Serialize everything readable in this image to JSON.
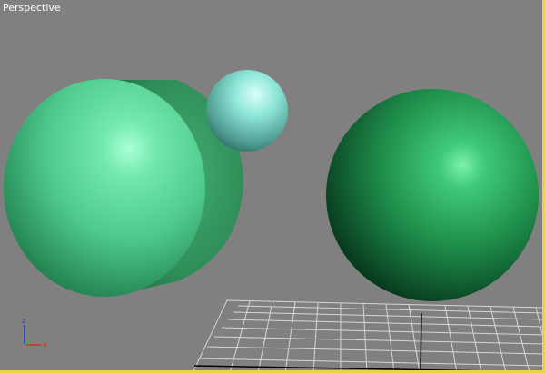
{
  "viewport": {
    "label": "Perspective",
    "background": "#808080",
    "border_color": "#e8d34a"
  },
  "axis_gizmo": {
    "z_label": "z",
    "y_label": "y",
    "x_label": "x",
    "z_color": "#1f3bd0",
    "y_color": "#2fbf3a",
    "x_color": "#d22f1a"
  },
  "objects": [
    {
      "name": "cylinder",
      "color": "#3b9a62"
    },
    {
      "name": "sphere-large-left",
      "color": "#5fd29a"
    },
    {
      "name": "sphere-small",
      "color": "#7fe0d6"
    },
    {
      "name": "sphere-right",
      "color": "#1f8a47"
    }
  ],
  "grid": {
    "color": "#d8d8d8",
    "axis_color": "#000000"
  }
}
